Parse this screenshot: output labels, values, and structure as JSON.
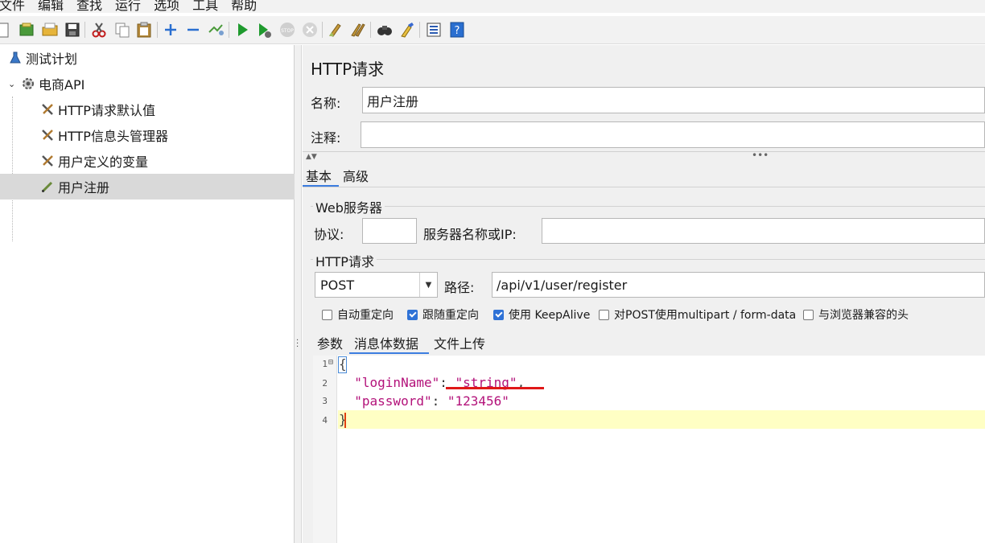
{
  "menu": [
    "文件",
    "编辑",
    "查找",
    "运行",
    "选项",
    "工具",
    "帮助"
  ],
  "toolbar_icons": [
    "new-icon",
    "template-icon",
    "open-icon",
    "save-icon",
    "cut-icon",
    "copy-icon",
    "paste-icon",
    "expand-icon",
    "collapse-icon",
    "toggle-icon",
    "start-icon",
    "start-no-pause-icon",
    "stop-icon",
    "shutdown-icon",
    "clear-icon",
    "clear-all-icon",
    "search-icon",
    "reset-search-icon",
    "function-helper-icon",
    "help-icon"
  ],
  "tree": {
    "items": [
      {
        "label": "测试计划",
        "icon": "test-plan-icon"
      },
      {
        "label": "电商API",
        "icon": "thread-group-gear-icon"
      },
      {
        "label": "HTTP请求默认值",
        "icon": "config-tool-icon"
      },
      {
        "label": "HTTP信息头管理器",
        "icon": "config-tool-icon"
      },
      {
        "label": "用户定义的变量",
        "icon": "config-tool-icon"
      },
      {
        "label": "用户注册",
        "icon": "sampler-pen-icon"
      }
    ]
  },
  "panel": {
    "title": "HTTP请求",
    "name_label": "名称:",
    "name_value": "用户注册",
    "comment_label": "注释:",
    "comment_value": "",
    "tabs": [
      "基本",
      "高级"
    ],
    "web_server_group": "Web服务器",
    "protocol_label": "协议:",
    "protocol_value": "",
    "server_label": "服务器名称或IP:",
    "server_value": "",
    "http_request_group": "HTTP请求",
    "method": "POST",
    "path_label": "路径:",
    "path_value": "/api/v1/user/register",
    "checkboxes": [
      {
        "label": "自动重定向",
        "checked": false
      },
      {
        "label": "跟随重定向",
        "checked": true
      },
      {
        "label": "使用 KeepAlive",
        "checked": true
      },
      {
        "label": "对POST使用multipart / form-data",
        "checked": false
      },
      {
        "label": "与浏览器兼容的头",
        "checked": false
      }
    ],
    "body_tabs": [
      "参数",
      "消息体数据",
      "文件上传"
    ],
    "code": {
      "line_numbers": [
        "1",
        "2",
        "3",
        "4"
      ],
      "open_brace": "{",
      "key1": "\"loginName\"",
      "colon1": ": ",
      "val1": "\"string\"",
      "comma1": ",",
      "key2": "\"password\"",
      "colon2": ": ",
      "val2": "\"123456\"",
      "close_brace": "}"
    }
  },
  "colors": {
    "accent": "#3d7ee0",
    "code_string": "#b3127a",
    "annotation_red": "#e01818",
    "current_line": "#ffffc4"
  }
}
